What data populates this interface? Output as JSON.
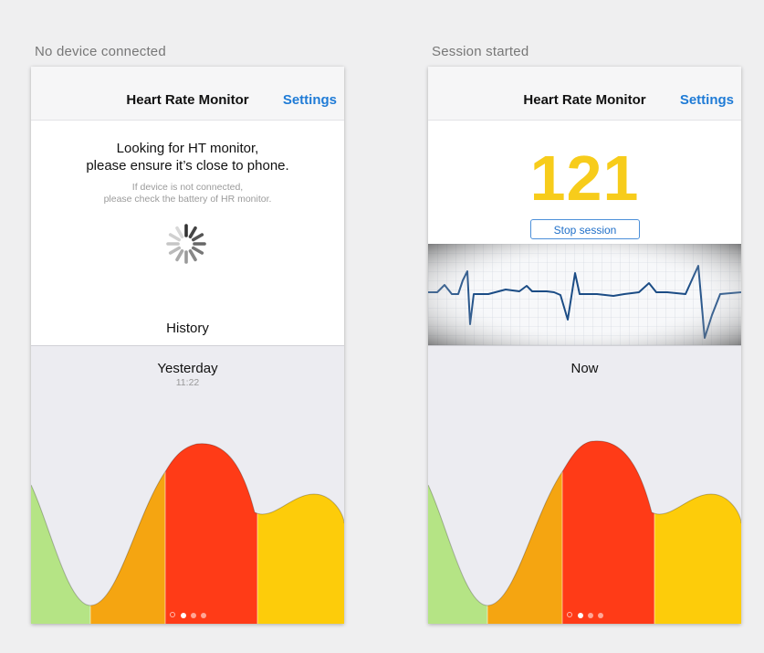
{
  "captions": {
    "left": "No device connected",
    "right": "Session started"
  },
  "left_screen": {
    "nav_title": "Heart Rate Monitor",
    "nav_action": "Settings",
    "search_title_line1": "Looking for HT monitor,",
    "search_title_line2": "please ensure it’s close to phone.",
    "note_line1": "If device is not connected,",
    "note_line2": "please check the battery of HR monitor.",
    "section_title": "History",
    "chart_label": "Yesterday",
    "chart_sublabel": "11:22",
    "page_dots": 4,
    "active_dot": 1
  },
  "right_screen": {
    "nav_title": "Heart Rate Monitor",
    "nav_action": "Settings",
    "heart_rate": "121",
    "stop_button": "Stop session",
    "chart_label": "Now",
    "page_dots": 4,
    "active_dot": 1
  },
  "colors": {
    "accent": "#1f7bd6",
    "bpm": "#f7cc1b",
    "zone_green": "#b5e485",
    "zone_orange": "#f5a511",
    "zone_red": "#ff3b17",
    "zone_yellow": "#fdcc0a",
    "ecg_line": "#1b4c85"
  }
}
